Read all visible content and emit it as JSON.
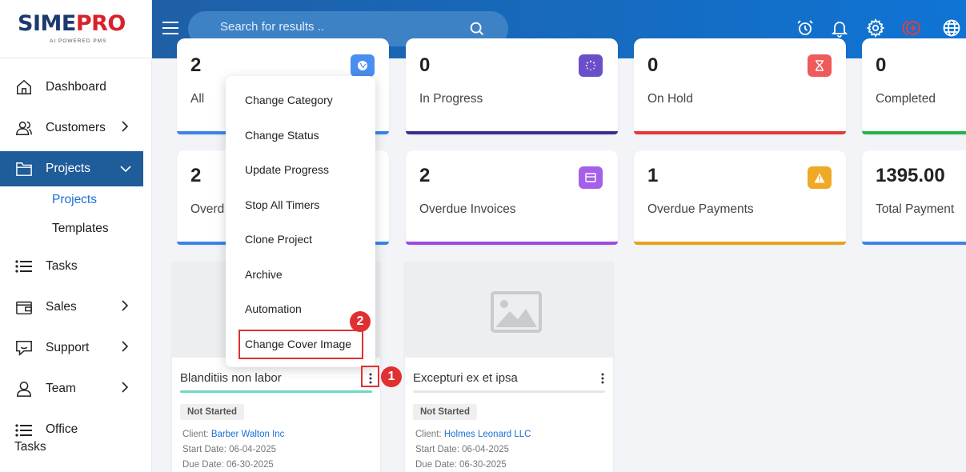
{
  "logo": {
    "part1": "SIME",
    "part2": "PRO",
    "tagline": "AI POWERED PMS"
  },
  "search": {
    "placeholder": "Search for results .."
  },
  "sidebar": {
    "items": [
      {
        "label": "Dashboard"
      },
      {
        "label": "Customers"
      },
      {
        "label": "Projects"
      },
      {
        "label": "Tasks"
      },
      {
        "label": "Sales"
      },
      {
        "label": "Support"
      },
      {
        "label": "Team"
      },
      {
        "label_line1": "Office",
        "label_line2": "Tasks"
      }
    ],
    "subitems": [
      {
        "label": "Projects"
      },
      {
        "label": "Templates"
      }
    ]
  },
  "stats": [
    {
      "value": "2",
      "label": "All",
      "color": "#3c83ea"
    },
    {
      "value": "0",
      "label": "In Progress",
      "color": "#3a2d8e"
    },
    {
      "value": "0",
      "label": "On Hold",
      "color": "#e2393b"
    },
    {
      "value": "0",
      "label": "Completed",
      "color": "#25b24b"
    },
    {
      "value": "2",
      "label": "Overd",
      "color": "#3c83ea"
    },
    {
      "value": "2",
      "label": "Overdue Invoices",
      "color": "#9b4be2"
    },
    {
      "value": "1",
      "label": "Overdue Payments",
      "color": "#e8a21c"
    },
    {
      "value": "1395.00",
      "label": "Total Payment",
      "color": "#3c83ea"
    }
  ],
  "menu": {
    "items": [
      "Change Category",
      "Change Status",
      "Update Progress",
      "Stop All Timers",
      "Clone Project",
      "Archive",
      "Automation",
      "Change Cover Image"
    ]
  },
  "projects": [
    {
      "name": "Blanditiis non labor",
      "status": "Not Started",
      "client_label": "Client:",
      "client": "Barber Walton Inc",
      "start": "Start Date: 06-04-2025",
      "due": "Due Date: 06-30-2025",
      "progress_color": "#6fd9c0"
    },
    {
      "name": "Excepturi ex et ipsa",
      "status": "Not Started",
      "client_label": "Client:",
      "client": "Holmes Leonard LLC",
      "start": "Start Date: 06-04-2025",
      "due": "Due Date: 06-30-2025",
      "progress_color": "#e6e6e6"
    }
  ],
  "annotations": {
    "step1": "1",
    "step2": "2",
    "color": "#e03030"
  },
  "icons": [
    "hamburger-icon",
    "search-icon",
    "alarm-icon",
    "bell-icon",
    "gear-icon",
    "add-circle-icon",
    "globe-icon",
    "home-icon",
    "users-icon",
    "folder-icon",
    "list-icon",
    "wallet-icon",
    "chat-icon",
    "user-icon",
    "kebab-icon",
    "image-placeholder-icon"
  ]
}
